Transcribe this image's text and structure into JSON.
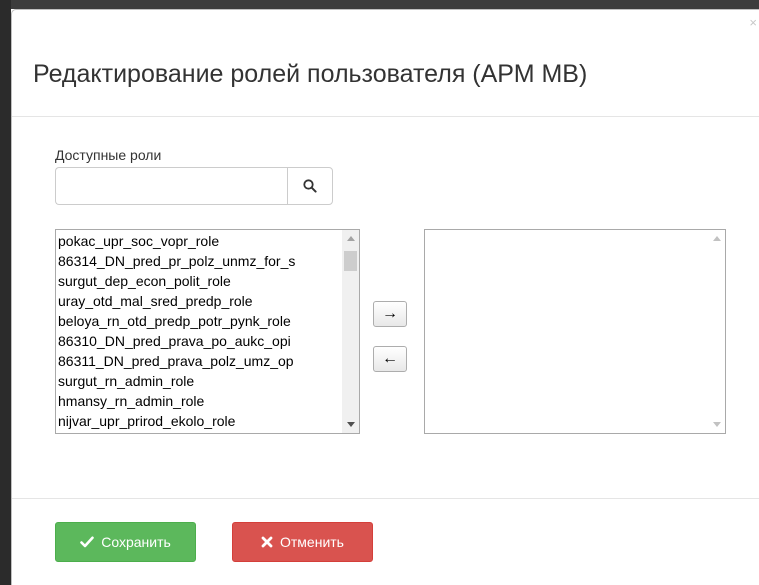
{
  "dialog": {
    "title": "Редактирование ролей пользователя (АРМ МВ)",
    "close_glyph": "×"
  },
  "search": {
    "label": "Доступные роли",
    "value": "",
    "icon": "search-icon"
  },
  "available_roles": [
    "pokac_upr_soc_vopr_role",
    "86314_DN_pred_pr_polz_unmz_for_s",
    "surgut_dep_econ_polit_role",
    "uray_otd_mal_sred_predp_role",
    "beloya_rn_otd_predp_potr_pynk_role",
    "86310_DN_pred_prava_po_aukc_opi",
    "86311_DN_pred_prava_polz_umz_op",
    "surgut_rn_admin_role",
    "hmansy_rn_admin_role",
    "nijvar_upr_prirod_ekolo_role"
  ],
  "assigned_roles": [],
  "transfer": {
    "add_glyph": "→",
    "remove_glyph": "←"
  },
  "footer": {
    "save_label": "Сохранить",
    "save_icon": "check-icon",
    "cancel_label": "Отменить",
    "cancel_icon": "x-icon"
  },
  "colors": {
    "save": "#5cb85c",
    "cancel": "#d9534f"
  }
}
